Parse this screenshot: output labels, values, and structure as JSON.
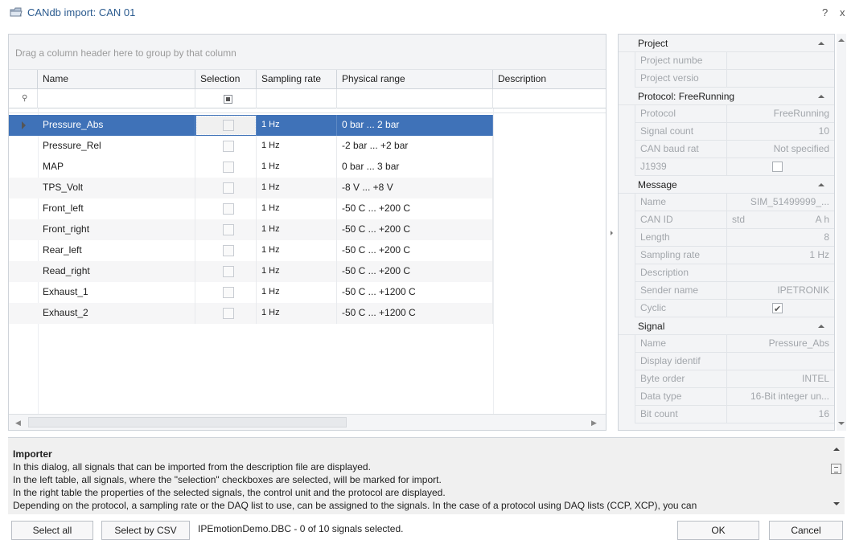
{
  "window": {
    "title": "CANdb import: CAN 01",
    "help_glyph": "?",
    "close_glyph": "x"
  },
  "grid": {
    "group_panel_text": "Drag a column header here to group by that column",
    "columns": [
      "Name",
      "Selection",
      "Sampling rate",
      "Physical range",
      "Description"
    ],
    "rows": [
      {
        "name": "Pressure_Abs",
        "rate": "1 Hz",
        "range": "0 bar ... 2 bar",
        "selected": true
      },
      {
        "name": "Pressure_Rel",
        "rate": "1 Hz",
        "range": "-2 bar ... +2 bar",
        "selected": false
      },
      {
        "name": "MAP",
        "rate": "1 Hz",
        "range": "0 bar ... 3 bar",
        "selected": false
      },
      {
        "name": "TPS_Volt",
        "rate": "1 Hz",
        "range": "-8 V ... +8 V",
        "selected": false
      },
      {
        "name": "Front_left",
        "rate": "1 Hz",
        "range": "-50 C ... +200 C",
        "selected": false
      },
      {
        "name": "Front_right",
        "rate": "1 Hz",
        "range": "-50 C ... +200 C",
        "selected": false
      },
      {
        "name": "Rear_left",
        "rate": "1 Hz",
        "range": "-50 C ... +200 C",
        "selected": false
      },
      {
        "name": "Read_right",
        "rate": "1 Hz",
        "range": "-50 C ... +200 C",
        "selected": false
      },
      {
        "name": "Exhaust_1",
        "rate": "1 Hz",
        "range": "-50 C ... +1200 C",
        "selected": false
      },
      {
        "name": "Exhaust_2",
        "rate": "1 Hz",
        "range": "-50 C ... +1200 C",
        "selected": false
      }
    ]
  },
  "properties": {
    "project": {
      "title": "Project",
      "rows": [
        {
          "key": "Project numbe",
          "value": ""
        },
        {
          "key": "Project versio",
          "value": ""
        }
      ]
    },
    "protocol": {
      "title": "Protocol: FreeRunning",
      "rows": [
        {
          "key": "Protocol",
          "value": "FreeRunning"
        },
        {
          "key": "Signal count",
          "value": "10"
        },
        {
          "key": "CAN baud rat",
          "value": "Not specified"
        },
        {
          "key": "J1939",
          "value": ""
        }
      ]
    },
    "message": {
      "title": "Message",
      "rows": [
        {
          "key": "Name",
          "value": "SIM_51499999_..."
        },
        {
          "key": "CAN ID",
          "value": "std",
          "extra": "A h"
        },
        {
          "key": "Length",
          "value": "8"
        },
        {
          "key": "Sampling rate",
          "value": "1 Hz"
        },
        {
          "key": "Description",
          "value": ""
        },
        {
          "key": "Sender name",
          "value": "IPETRONIK"
        },
        {
          "key": "Cyclic",
          "value": ""
        }
      ]
    },
    "signal": {
      "title": "Signal",
      "rows": [
        {
          "key": "Name",
          "value": "Pressure_Abs"
        },
        {
          "key": "Display identif",
          "value": ""
        },
        {
          "key": "Byte order",
          "value": "INTEL"
        },
        {
          "key": "Data type",
          "value": "16-Bit integer un..."
        },
        {
          "key": "Bit count",
          "value": "16"
        }
      ]
    }
  },
  "info": {
    "title": "Importer",
    "lines": [
      "In this dialog, all signals that can be imported from the description file are displayed.",
      "In the left table, all signals, where the \"selection\" checkboxes are selected, will be marked for import.",
      "In the right table the properties of the selected signals, the control unit and the protocol are displayed.",
      "Depending on the protocol, a sampling rate or the DAQ list to use, can be assigned to the signals. In the case of a protocol using DAQ lists (CCP, XCP), you can"
    ]
  },
  "footer": {
    "select_all": "Select all",
    "select_by_csv": "Select by CSV",
    "status": "IPEmotionDemo.DBC  -  0 of 10 signals selected.",
    "ok": "OK",
    "cancel": "Cancel"
  },
  "colors": {
    "selection": "#3f72b8",
    "title_text": "#2b5b8f",
    "panel_bg": "#f3f4f6"
  }
}
